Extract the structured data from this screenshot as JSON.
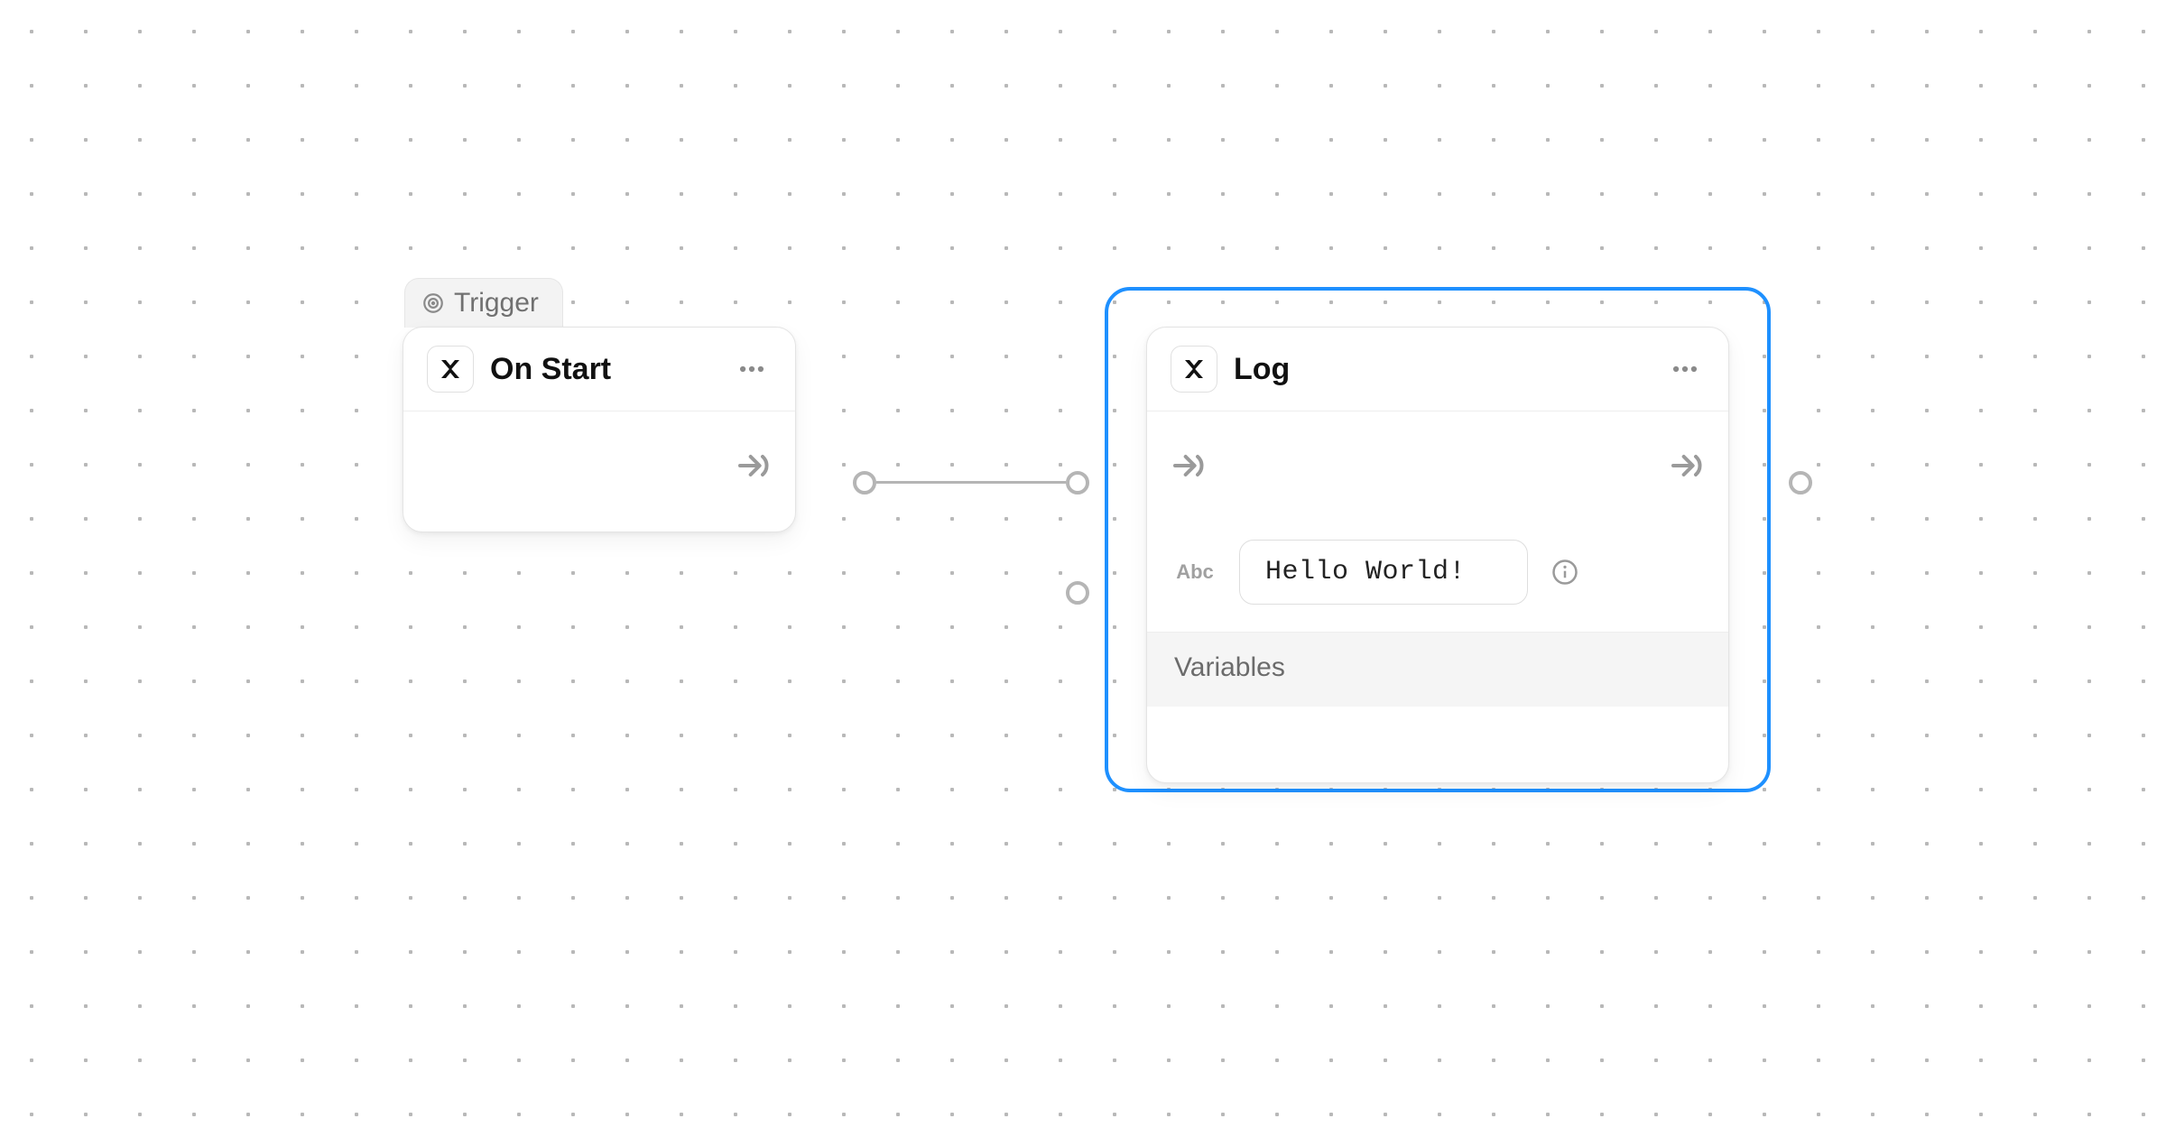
{
  "nodes": {
    "start": {
      "tag_label": "Trigger",
      "title": "On Start"
    },
    "log": {
      "title": "Log",
      "param_type_label": "Abc",
      "param_value": "Hello World!",
      "variables_label": "Variables"
    }
  }
}
